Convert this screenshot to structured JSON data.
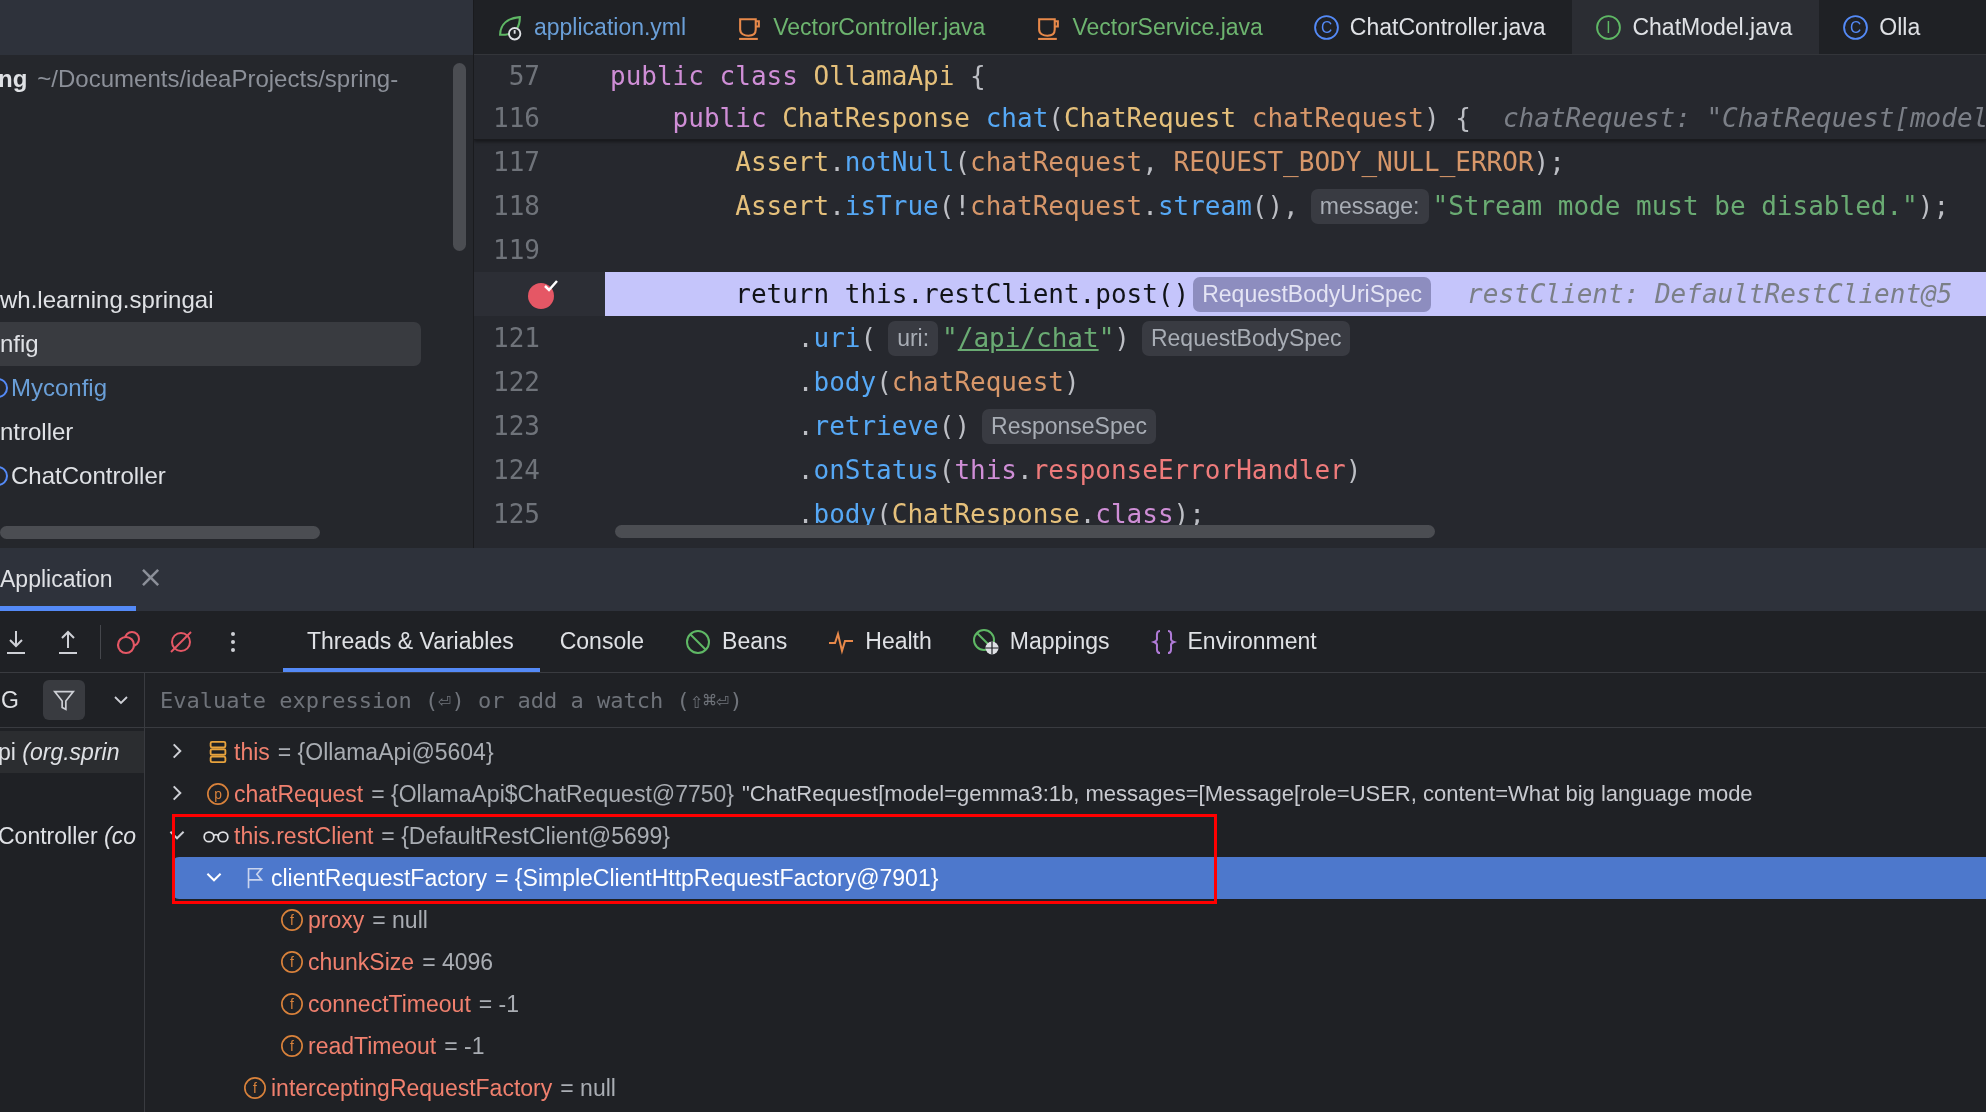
{
  "editor_tabs": [
    {
      "label": "application.yml",
      "kind": "yml",
      "color": "#6a9fd8",
      "selected": false
    },
    {
      "label": "VectorController.java",
      "kind": "java",
      "color": "#6db46f",
      "selected": false
    },
    {
      "label": "VectorService.java",
      "kind": "java",
      "color": "#6db46f",
      "selected": false
    },
    {
      "label": "ChatController.java",
      "kind": "class",
      "badge": "C",
      "color": "#dfe1e5",
      "selected": false
    },
    {
      "label": "ChatModel.java",
      "kind": "interface",
      "badge": "I",
      "color": "#dfe1e5",
      "selected": true
    },
    {
      "label": "Olla",
      "kind": "class",
      "badge": "C",
      "color": "#dfe1e5",
      "selected": false
    }
  ],
  "project": {
    "name": "ng",
    "path": "~/Documents/ideaProjects/spring-",
    "tree": [
      {
        "label": "wh.learning.springai",
        "kind": "package",
        "color": "#dfe1e5",
        "selected": false,
        "children": [
          {
            "label": "nfig",
            "kind": "package",
            "color": "#dfe1e5",
            "selected": true,
            "children": [
              {
                "label": "Myconfig",
                "kind": "class",
                "color": "#6a9fd8",
                "selected": false
              }
            ]
          },
          {
            "label": "ntroller",
            "kind": "package",
            "color": "#dfe1e5",
            "selected": false,
            "children": [
              {
                "label": "ChatController",
                "kind": "class",
                "color": "#dfe1e5",
                "selected": false
              }
            ]
          }
        ]
      }
    ]
  },
  "code": {
    "sticky_lines": [
      {
        "number": "57",
        "segments": [
          {
            "kind": "code",
            "tokens": [
              {
                "t": "public class ",
                "kind": "keyword"
              },
              {
                "t": "OllamaApi",
                "kind": "type"
              },
              {
                "t": " {",
                "kind": "plain"
              }
            ]
          }
        ]
      },
      {
        "number": "116",
        "segments": [
          {
            "kind": "code",
            "tokens": [
              {
                "t": "    public ",
                "kind": "keyword"
              },
              {
                "t": "ChatResponse ",
                "kind": "type"
              },
              {
                "t": "chat",
                "kind": "method"
              },
              {
                "t": "(",
                "kind": "plain"
              },
              {
                "t": "ChatRequest ",
                "kind": "type"
              },
              {
                "t": "chatRequest",
                "kind": "param"
              },
              {
                "t": ") {",
                "kind": "plain"
              }
            ]
          },
          {
            "kind": "value",
            "text": "chatRequest: \"ChatRequest[model"
          }
        ]
      }
    ],
    "lines": [
      {
        "number": "117",
        "breakpoint": false,
        "current": false,
        "segments": [
          {
            "kind": "code",
            "tokens": [
              {
                "t": "        Assert",
                "kind": "type"
              },
              {
                "t": ".",
                "kind": "plain"
              },
              {
                "t": "notNull",
                "kind": "method"
              },
              {
                "t": "(",
                "kind": "plain"
              },
              {
                "t": "chatRequest",
                "kind": "param"
              },
              {
                "t": ", ",
                "kind": "plain"
              },
              {
                "t": "REQUEST_BODY_NULL_ERROR",
                "kind": "param"
              },
              {
                "t": ");",
                "kind": "plain"
              }
            ]
          }
        ]
      },
      {
        "number": "118",
        "breakpoint": false,
        "current": false,
        "segments": [
          {
            "kind": "code",
            "tokens": [
              {
                "t": "        Assert",
                "kind": "type"
              },
              {
                "t": ".",
                "kind": "plain"
              },
              {
                "t": "isTrue",
                "kind": "method"
              },
              {
                "t": "(!",
                "kind": "plain"
              },
              {
                "t": "chatRequest",
                "kind": "param"
              },
              {
                "t": ".",
                "kind": "plain"
              },
              {
                "t": "stream",
                "kind": "method"
              },
              {
                "t": "(),",
                "kind": "plain"
              }
            ]
          },
          {
            "kind": "hint",
            "text": "message:"
          },
          {
            "kind": "code",
            "tokens": [
              {
                "t": "\"Stream mode must be disabled.\"",
                "kind": "string"
              },
              {
                "t": ");",
                "kind": "plain"
              }
            ]
          }
        ]
      },
      {
        "number": "119",
        "breakpoint": false,
        "current": false
      },
      {
        "breakpoint": true,
        "current": true,
        "segments": [
          {
            "kind": "code",
            "tokens": [
              {
                "t": "        return this.restClient.post()",
                "kind": "plain"
              }
            ]
          },
          {
            "kind": "hint",
            "text": "RequestBodyUriSpec"
          },
          {
            "kind": "value",
            "text": "restClient: DefaultRestClient@5"
          }
        ]
      },
      {
        "number": "121",
        "breakpoint": false,
        "current": false,
        "segments": [
          {
            "kind": "code",
            "tokens": [
              {
                "t": "            .",
                "kind": "plain"
              },
              {
                "t": "uri",
                "kind": "method"
              },
              {
                "t": "(",
                "kind": "plain"
              }
            ]
          },
          {
            "kind": "hint",
            "text": "uri:"
          },
          {
            "kind": "code",
            "tokens": [
              {
                "t": "\"",
                "kind": "string"
              },
              {
                "t": "/api/chat",
                "kind": "link"
              },
              {
                "t": "\"",
                "kind": "string"
              },
              {
                "t": ")",
                "kind": "plain"
              }
            ]
          },
          {
            "kind": "hint",
            "text": "RequestBodySpec"
          }
        ]
      },
      {
        "number": "122",
        "breakpoint": false,
        "current": false,
        "segments": [
          {
            "kind": "code",
            "tokens": [
              {
                "t": "            .",
                "kind": "plain"
              },
              {
                "t": "body",
                "kind": "method"
              },
              {
                "t": "(",
                "kind": "plain"
              },
              {
                "t": "chatRequest",
                "kind": "param"
              },
              {
                "t": ")",
                "kind": "plain"
              }
            ]
          }
        ]
      },
      {
        "number": "123",
        "breakpoint": false,
        "current": false,
        "segments": [
          {
            "kind": "code",
            "tokens": [
              {
                "t": "            .",
                "kind": "plain"
              },
              {
                "t": "retrieve",
                "kind": "method"
              },
              {
                "t": "()",
                "kind": "plain"
              }
            ]
          },
          {
            "kind": "hint",
            "text": "ResponseSpec"
          }
        ]
      },
      {
        "number": "124",
        "breakpoint": false,
        "current": false,
        "segments": [
          {
            "kind": "code",
            "tokens": [
              {
                "t": "            .",
                "kind": "plain"
              },
              {
                "t": "onStatus",
                "kind": "method"
              },
              {
                "t": "(",
                "kind": "plain"
              },
              {
                "t": "this",
                "kind": "keyword"
              },
              {
                "t": ".",
                "kind": "plain"
              },
              {
                "t": "responseErrorHandler",
                "kind": "field"
              },
              {
                "t": ")",
                "kind": "plain"
              }
            ]
          }
        ]
      },
      {
        "number": "125",
        "breakpoint": false,
        "current": false,
        "segments": [
          {
            "kind": "code",
            "tokens": [
              {
                "t": "            .",
                "kind": "plain"
              },
              {
                "t": "body",
                "kind": "method"
              },
              {
                "t": "(",
                "kind": "plain"
              },
              {
                "t": "ChatResponse",
                "kind": "type"
              },
              {
                "t": ".",
                "kind": "plain"
              },
              {
                "t": "class",
                "kind": "keyword"
              },
              {
                "t": ");",
                "kind": "plain"
              }
            ]
          }
        ]
      }
    ]
  },
  "debug": {
    "session_tab": {
      "label": "Application",
      "close": "×",
      "selected": true
    },
    "tabs": [
      {
        "label": "Threads & Variables",
        "kind": "threads",
        "selected": true
      },
      {
        "label": "Console",
        "kind": "console",
        "selected": false
      },
      {
        "label": "Beans",
        "kind": "beans",
        "selected": false
      },
      {
        "label": "Health",
        "kind": "health",
        "selected": false
      },
      {
        "label": "Mappings",
        "kind": "mappings",
        "selected": false
      },
      {
        "label": "Environment",
        "kind": "environment",
        "selected": false
      }
    ],
    "frames_header": "G",
    "frames": [
      {
        "label": "pi *(org.sprin*",
        "selected": true
      },
      {
        "label": "Controller *(co*",
        "selected": false
      }
    ],
    "evaluate": {
      "placeholder": "Evaluate expression (⏎) or add a watch (⇧⌘⏎)"
    },
    "variables": [
      {
        "name": "this",
        "value": "= {OllamaApi@5604}",
        "kind": "object",
        "expanded": false,
        "selected": false
      },
      {
        "name": "chatRequest",
        "value": "= {OllamaApi$ChatRequest@7750}",
        "detail": "\"ChatRequest[model=gemma3:1b, messages=[Message[role=USER, content=What big language mode",
        "kind": "param",
        "badge": "p",
        "expanded": false,
        "selected": false
      },
      {
        "name": "this.restClient",
        "value": "= {DefaultRestClient@5699}",
        "kind": "watch",
        "expanded": true,
        "selected": false,
        "children": [
          {
            "name": "clientRequestFactory",
            "value": "= {SimpleClientHttpRequestFactory@7901}",
            "kind": "flag",
            "expanded": true,
            "selected": true,
            "children": [
              {
                "name": "proxy",
                "value": "= null",
                "kind": "field",
                "badge": "f",
                "selected": false
              },
              {
                "name": "chunkSize",
                "value": "= 4096",
                "kind": "field",
                "badge": "f",
                "selected": false
              },
              {
                "name": "connectTimeout",
                "value": "= -1",
                "kind": "field",
                "badge": "f",
                "selected": false
              },
              {
                "name": "readTimeout",
                "value": "= -1",
                "kind": "field",
                "badge": "f",
                "selected": false
              }
            ]
          },
          {
            "name": "interceptingRequestFactory",
            "value": "= null",
            "kind": "field",
            "badge": "f",
            "selected": false
          }
        ]
      }
    ],
    "annotations": [
      {
        "kind": "rectangle"
      }
    ]
  }
}
